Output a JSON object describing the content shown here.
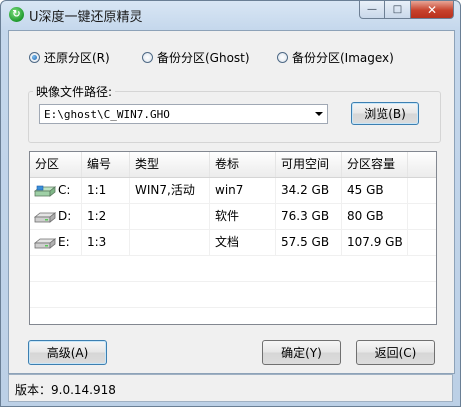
{
  "window": {
    "title": "U深度一键还原精灵"
  },
  "caption": {
    "min": "—",
    "max": "□",
    "close": "✕"
  },
  "modes": [
    {
      "label": "还原分区(R)",
      "checked": true
    },
    {
      "label": "备份分区(Ghost)",
      "checked": false
    },
    {
      "label": "备份分区(Imagex)",
      "checked": false
    }
  ],
  "image_path": {
    "group_label": "映像文件路径:",
    "value": "E:\\ghost\\C_WIN7.GHO",
    "browse_label": "浏览(B)"
  },
  "table": {
    "columns": [
      "分区",
      "编号",
      "类型",
      "卷标",
      "可用空间",
      "分区容量"
    ],
    "rows": [
      {
        "drive": "C:",
        "number": "1:1",
        "type": "WIN7,活动",
        "label": "win7",
        "free": "34.2 GB",
        "size": "45 GB",
        "icon": "system-drive-icon"
      },
      {
        "drive": "D:",
        "number": "1:2",
        "type": "",
        "label": "软件",
        "free": "76.3 GB",
        "size": "80 GB",
        "icon": "hard-drive-icon"
      },
      {
        "drive": "E:",
        "number": "1:3",
        "type": "",
        "label": "文档",
        "free": "57.5 GB",
        "size": "107.9 GB",
        "icon": "hard-drive-icon"
      }
    ]
  },
  "buttons": {
    "advanced": "高级(A)",
    "ok": "确定(Y)",
    "back": "返回(C)"
  },
  "status": {
    "version": "版本：9.0.14.918"
  }
}
